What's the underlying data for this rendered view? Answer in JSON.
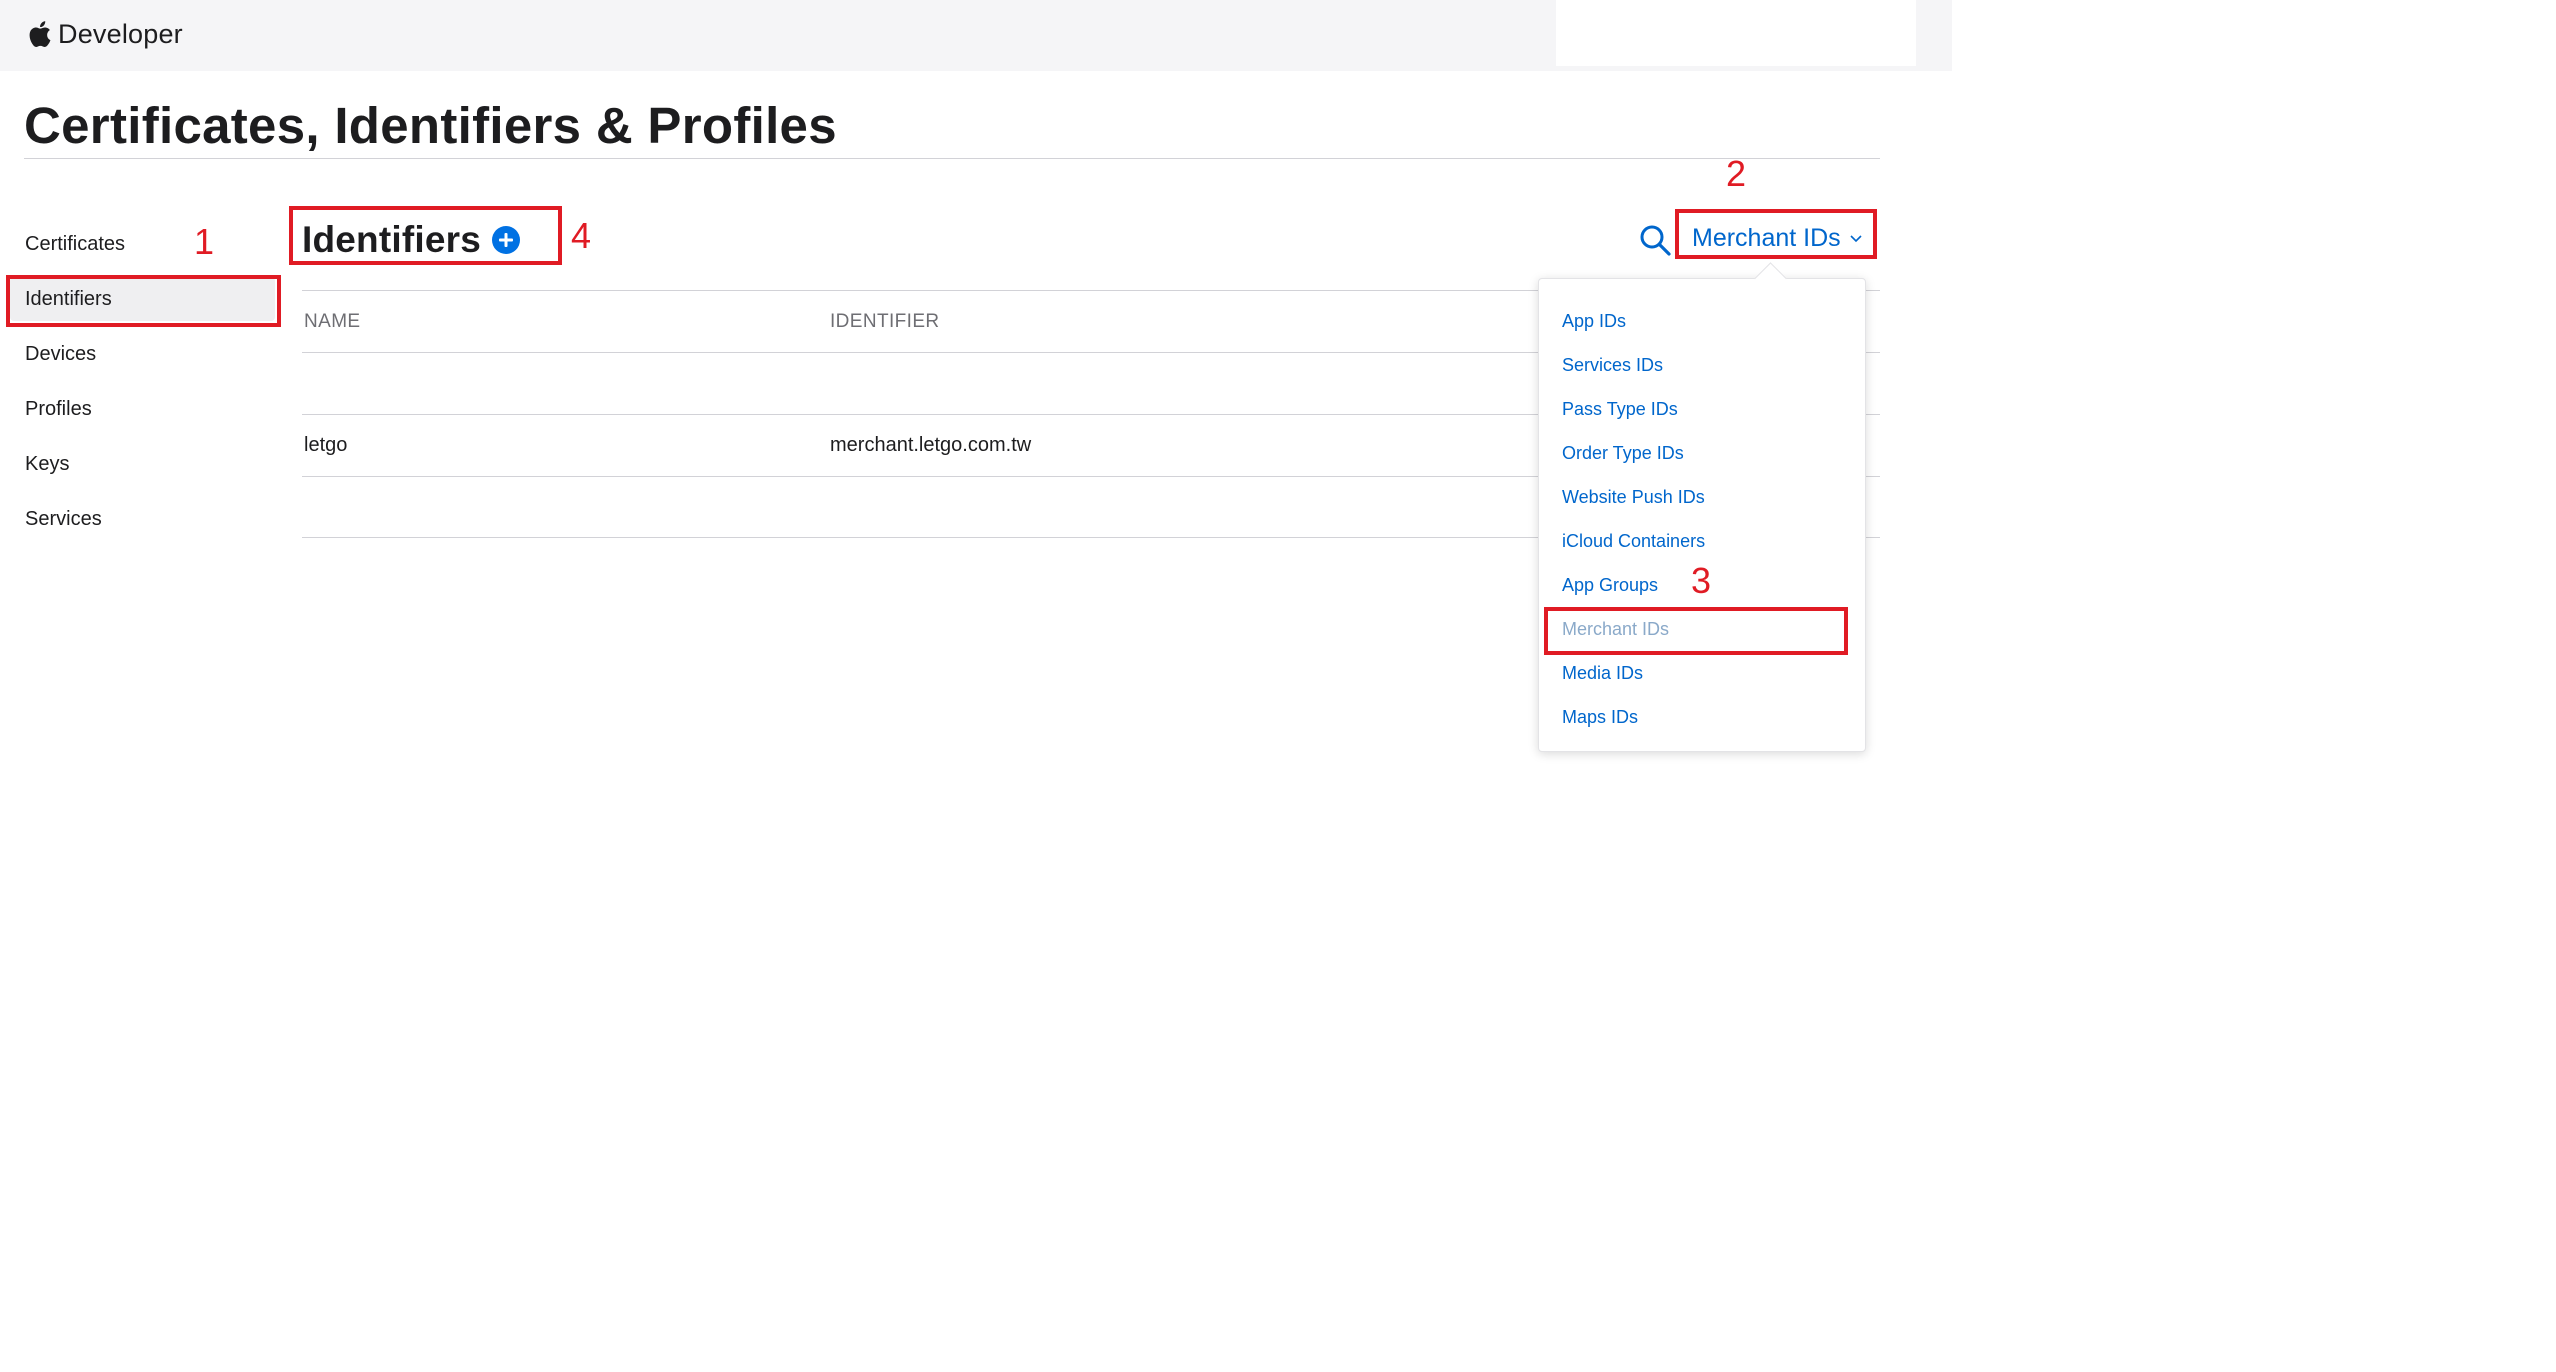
{
  "header": {
    "brand": "Developer",
    "icon": "apple-logo-icon"
  },
  "page": {
    "title": "Certificates, Identifiers & Profiles"
  },
  "sidebar": {
    "items": [
      {
        "label": "Certificates"
      },
      {
        "label": "Identifiers",
        "active": true
      },
      {
        "label": "Devices"
      },
      {
        "label": "Profiles"
      },
      {
        "label": "Keys"
      },
      {
        "label": "Services"
      }
    ]
  },
  "main": {
    "section_title": "Identifiers",
    "add_icon": "plus-circle-icon",
    "search_icon": "search-icon",
    "filter": {
      "selected": "Merchant IDs",
      "icon": "chevron-down-icon"
    },
    "table": {
      "columns": [
        "NAME",
        "IDENTIFIER"
      ],
      "rows": [
        {
          "name": "letgo",
          "identifier": "merchant.letgo.com.tw"
        }
      ]
    }
  },
  "dropdown": {
    "items": [
      {
        "label": "App IDs"
      },
      {
        "label": "Services IDs"
      },
      {
        "label": "Pass Type IDs"
      },
      {
        "label": "Order Type IDs"
      },
      {
        "label": "Website Push IDs"
      },
      {
        "label": "iCloud Containers"
      },
      {
        "label": "App Groups"
      },
      {
        "label": "Merchant IDs",
        "selected": true
      },
      {
        "label": "Media IDs"
      },
      {
        "label": "Maps IDs"
      }
    ]
  },
  "annotations": {
    "n1": "1",
    "n2": "2",
    "n3": "3",
    "n4": "4"
  },
  "colors": {
    "link": "#0066cc",
    "annotation": "#e01b24",
    "nav_bg": "#f5f5f7"
  }
}
